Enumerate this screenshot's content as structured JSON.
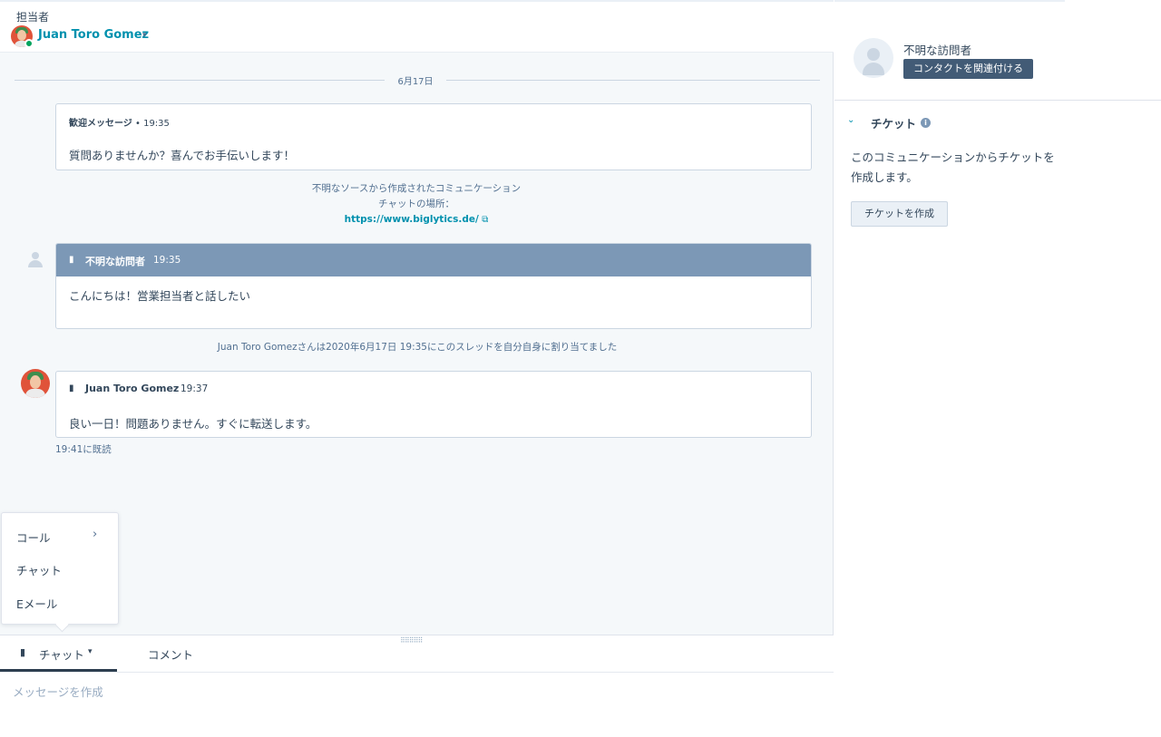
{
  "header": {
    "owner_label": "担当者",
    "owner_name": "Juan Toro Gomez",
    "caret_icon": "▾"
  },
  "thread": {
    "date_label": "6月17日",
    "welcome": {
      "label": "歓迎メッセージ",
      "separator": " • ",
      "time": "19:35",
      "text": "質問ありませんか？喜んでお手伝いします！"
    },
    "source": {
      "line1": "不明なソースから作成されたコミュニケーション",
      "line2": "チャットの場所：",
      "url": "https://www.biglytics.de/",
      "external_icon": "⧉"
    },
    "visitor_message": {
      "sender": "不明な訪問者",
      "time": "19:35",
      "text": "こんにちは！営業担当者と話したい"
    },
    "assignment_note": "Juan Toro Gomezさんは2020年6月17日 19:35にこのスレッドを自分自身に割り当てました",
    "agent_message": {
      "sender": "Juan Toro Gomez",
      "time": "19:37",
      "text": "良い一日！問題ありません。すぐに転送します。"
    },
    "read_receipt": "19:41に既読"
  },
  "channel_menu": {
    "items": [
      "コール",
      "チャット",
      "Eメール"
    ],
    "chevron": "›"
  },
  "composer": {
    "grip": "⠿⠿⠿⠿⠿",
    "chat_tab": "チャット",
    "chat_caret": "▾",
    "comment_tab": "コメント",
    "placeholder": "メッセージを作成"
  },
  "sidebar": {
    "contact_name": "不明な訪問者",
    "associate_button": "コンタクトを関連付ける",
    "ticket_toggle": "⌄",
    "ticket_title": "チケット",
    "info_icon": "i",
    "ticket_description": "このコミュニケーションからチケットを作成します。",
    "create_ticket_button": "チケットを作成"
  },
  "colors": {
    "accent": "#0091ae",
    "visitor_header": "#7c98b6",
    "primary_button": "#425b76",
    "online_status": "#00a35c",
    "avatar_bg": "#e0533a"
  }
}
